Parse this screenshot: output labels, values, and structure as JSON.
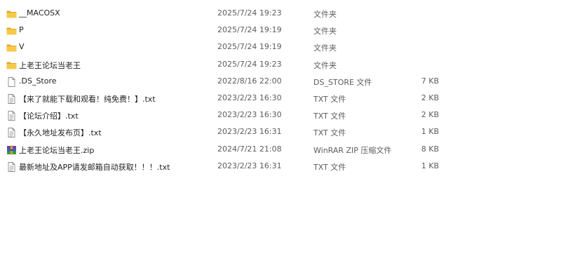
{
  "files": [
    {
      "icon": "folder-icon",
      "name": "__MACOSX",
      "date": "2025/7/24 19:23",
      "type": "文件夹",
      "size": ""
    },
    {
      "icon": "folder-icon",
      "name": "P",
      "date": "2025/7/24 19:19",
      "type": "文件夹",
      "size": ""
    },
    {
      "icon": "folder-icon",
      "name": "V",
      "date": "2025/7/24 19:19",
      "type": "文件夹",
      "size": ""
    },
    {
      "icon": "folder-icon",
      "name": "上老王论坛当老王",
      "date": "2025/7/24 19:23",
      "type": "文件夹",
      "size": ""
    },
    {
      "icon": "blank-file-icon",
      "name": ".DS_Store",
      "date": "2022/8/16 22:00",
      "type": "DS_STORE 文件",
      "size": "7 KB"
    },
    {
      "icon": "text-file-icon",
      "name": "【来了就能下载和观看！纯免费！】.txt",
      "date": "2023/2/23 16:30",
      "type": "TXT 文件",
      "size": "2 KB"
    },
    {
      "icon": "text-file-icon",
      "name": "【论坛介绍】.txt",
      "date": "2023/2/23 16:30",
      "type": "TXT 文件",
      "size": "2 KB"
    },
    {
      "icon": "text-file-icon",
      "name": "【永久地址发布页】.txt",
      "date": "2023/2/23 16:31",
      "type": "TXT 文件",
      "size": "1 KB"
    },
    {
      "icon": "winrar-archive-icon",
      "name": "上老王论坛当老王.zip",
      "date": "2024/7/21 21:08",
      "type": "WinRAR ZIP 压缩文件",
      "size": "8 KB"
    },
    {
      "icon": "text-file-icon",
      "name": "最新地址及APP请发邮箱自动获取！！！.txt",
      "date": "2023/2/23 16:31",
      "type": "TXT 文件",
      "size": "1 KB"
    }
  ],
  "colors": {
    "folder": "#f2c14e",
    "folder_dark": "#e3a82b",
    "text": "#1f1f1f",
    "meta_text": "#5c5c5c"
  }
}
